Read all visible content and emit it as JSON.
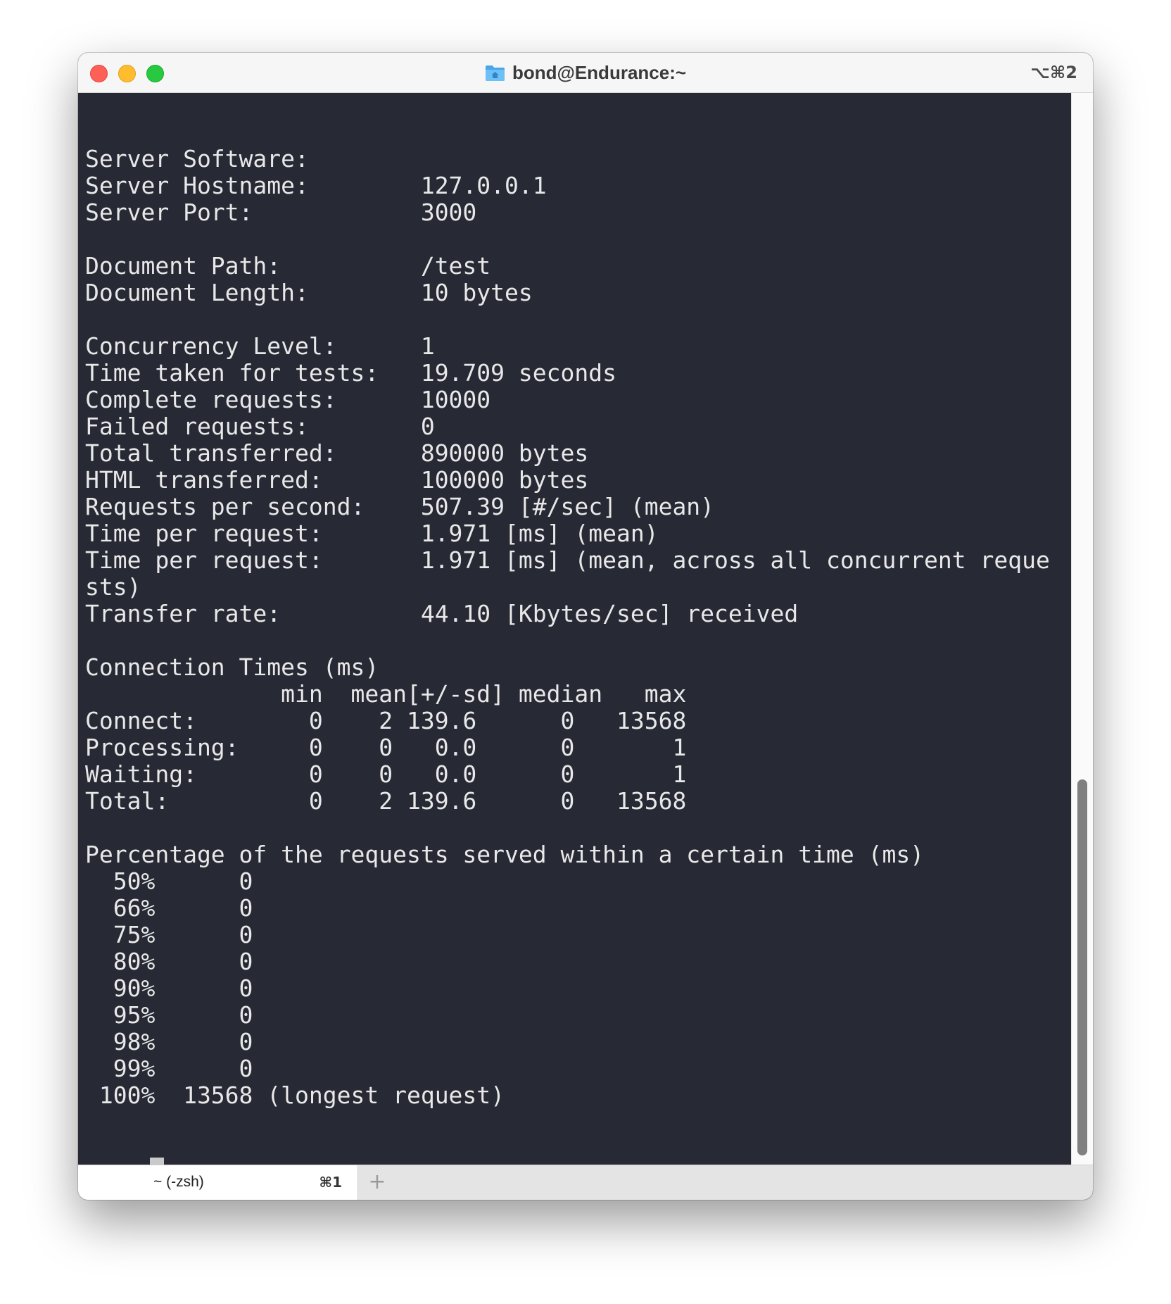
{
  "window": {
    "title": "bond@Endurance:~",
    "shortcut": "⌥⌘2"
  },
  "terminal": {
    "output": "Server Software:\nServer Hostname:        127.0.0.1\nServer Port:            3000\n\nDocument Path:          /test\nDocument Length:        10 bytes\n\nConcurrency Level:      1\nTime taken for tests:   19.709 seconds\nComplete requests:      10000\nFailed requests:        0\nTotal transferred:      890000 bytes\nHTML transferred:       100000 bytes\nRequests per second:    507.39 [#/sec] (mean)\nTime per request:       1.971 [ms] (mean)\nTime per request:       1.971 [ms] (mean, across all concurrent reque\nsts)\nTransfer rate:          44.10 [Kbytes/sec] received\n\nConnection Times (ms)\n              min  mean[+/-sd] median   max\nConnect:        0    2 139.6      0   13568\nProcessing:     0    0   0.0      0       1\nWaiting:        0    0   0.0      0       1\nTotal:          0    2 139.6      0   13568\n\nPercentage of the requests served within a certain time (ms)\n  50%      0\n  66%      0\n  75%      0\n  80%      0\n  90%      0\n  95%      0\n  98%      0\n  99%      0\n 100%  13568 (longest request)",
    "prompt_arrow": "➜",
    "prompt_dir": "~"
  },
  "tabs": [
    {
      "title": "~ (-zsh)",
      "shortcut": "⌘1"
    }
  ],
  "new_tab_label": "+",
  "colors": {
    "background": "#272935",
    "foreground": "#e8e8e8",
    "prompt_arrow": "#9fd52d",
    "prompt_dir": "#5ac8e8"
  },
  "icons": {
    "title": "folder-home-icon"
  }
}
